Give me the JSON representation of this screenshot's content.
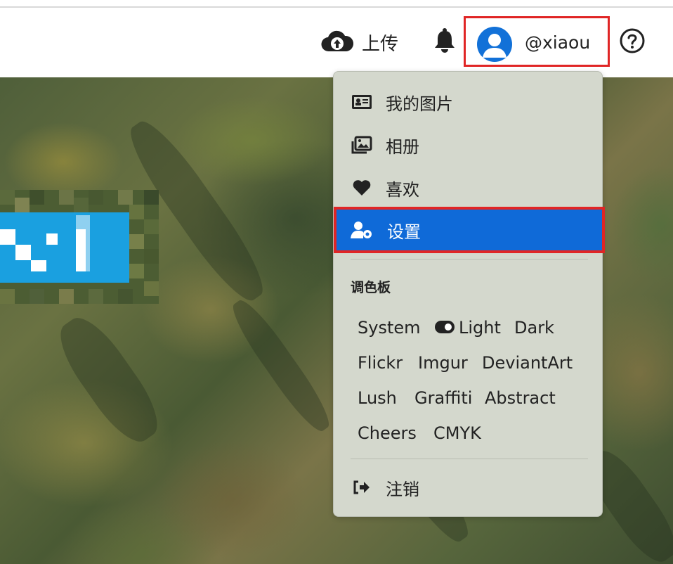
{
  "header": {
    "upload_label": "上传",
    "username": "@xiaou",
    "icons": {
      "upload": "cloud-upload-icon",
      "notifications": "bell-icon",
      "avatar": "user-avatar-icon",
      "help": "question-circle-icon"
    }
  },
  "menu": {
    "items": [
      {
        "label": "我的图片",
        "icon": "id-card-icon"
      },
      {
        "label": "相册",
        "icon": "albums-icon"
      },
      {
        "label": "喜欢",
        "icon": "heart-icon"
      },
      {
        "label": "设置",
        "icon": "user-cog-icon",
        "active": true
      }
    ],
    "palette_title": "调色板",
    "palettes": [
      "System",
      "Light",
      "Dark",
      "Flickr",
      "Imgur",
      "DeviantArt",
      "Lush",
      "Graffiti",
      "Abstract",
      "Cheers",
      "CMYK"
    ],
    "selected_palette": "Light",
    "logout_label": "注销"
  },
  "colors": {
    "accent": "#0f6ad8",
    "highlight_border": "#e02525"
  }
}
